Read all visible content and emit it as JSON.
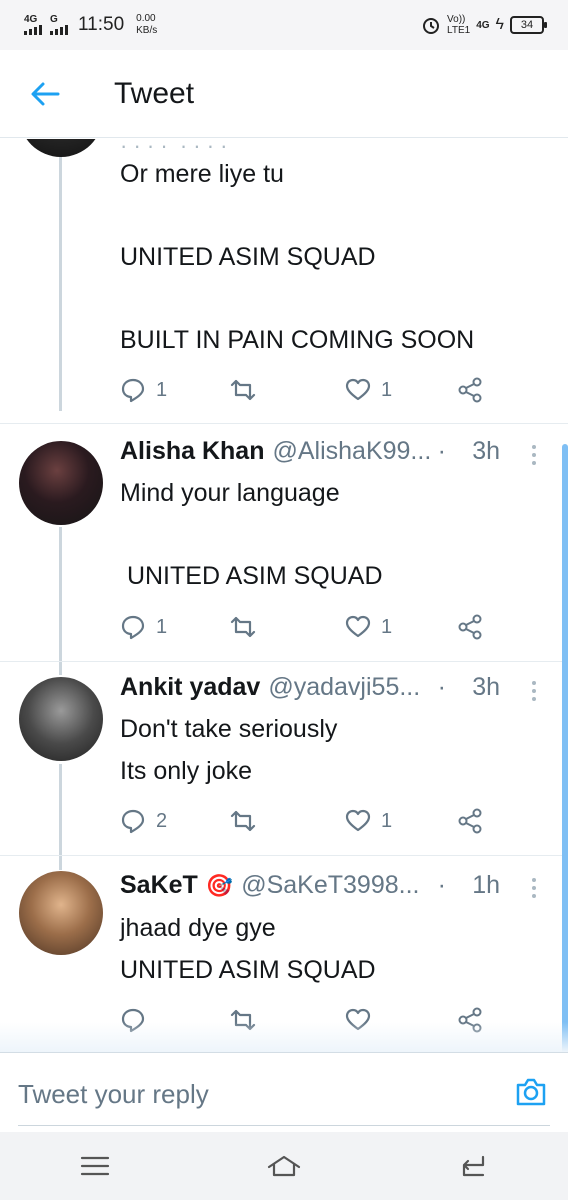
{
  "status_bar": {
    "sim1_net": "4G",
    "sim2_net": "G",
    "time": "11:50",
    "speed_value": "0.00",
    "speed_unit": "KB/s",
    "volte": "Vo))",
    "lte": "LTE1",
    "net_4g": "4G",
    "battery": "34"
  },
  "header": {
    "title": "Tweet",
    "accent_color": "#1da1f2"
  },
  "tweets": [
    {
      "lines": [
        "Or mere liye tu",
        "",
        "UNITED ASIM SQUAD",
        "",
        "BUILT IN PAIN COMING SOON"
      ],
      "replies": "1",
      "retweets": "",
      "likes": "1"
    },
    {
      "name": "Alisha Khan",
      "handle": "@AlishaK99...",
      "sep": "·",
      "time": "3h",
      "lines": [
        "Mind your language",
        "",
        " UNITED ASIM SQUAD"
      ],
      "replies": "1",
      "retweets": "",
      "likes": "1"
    },
    {
      "name": "Ankit yadav",
      "handle": "@yadavji55...",
      "sep": "·",
      "time": "3h",
      "lines": [
        "Don't take seriously",
        "Its only joke"
      ],
      "replies": "2",
      "retweets": "",
      "likes": "1"
    },
    {
      "name": "SaKeT",
      "emoji": "🎯",
      "handle": "@SaKeT3998...",
      "sep": "·",
      "time": "1h",
      "lines": [
        "jhaad dye gye",
        "UNITED ASIM SQUAD"
      ],
      "replies": "",
      "retweets": "",
      "likes": ""
    }
  ],
  "reply_bar": {
    "placeholder": "Tweet your reply"
  }
}
